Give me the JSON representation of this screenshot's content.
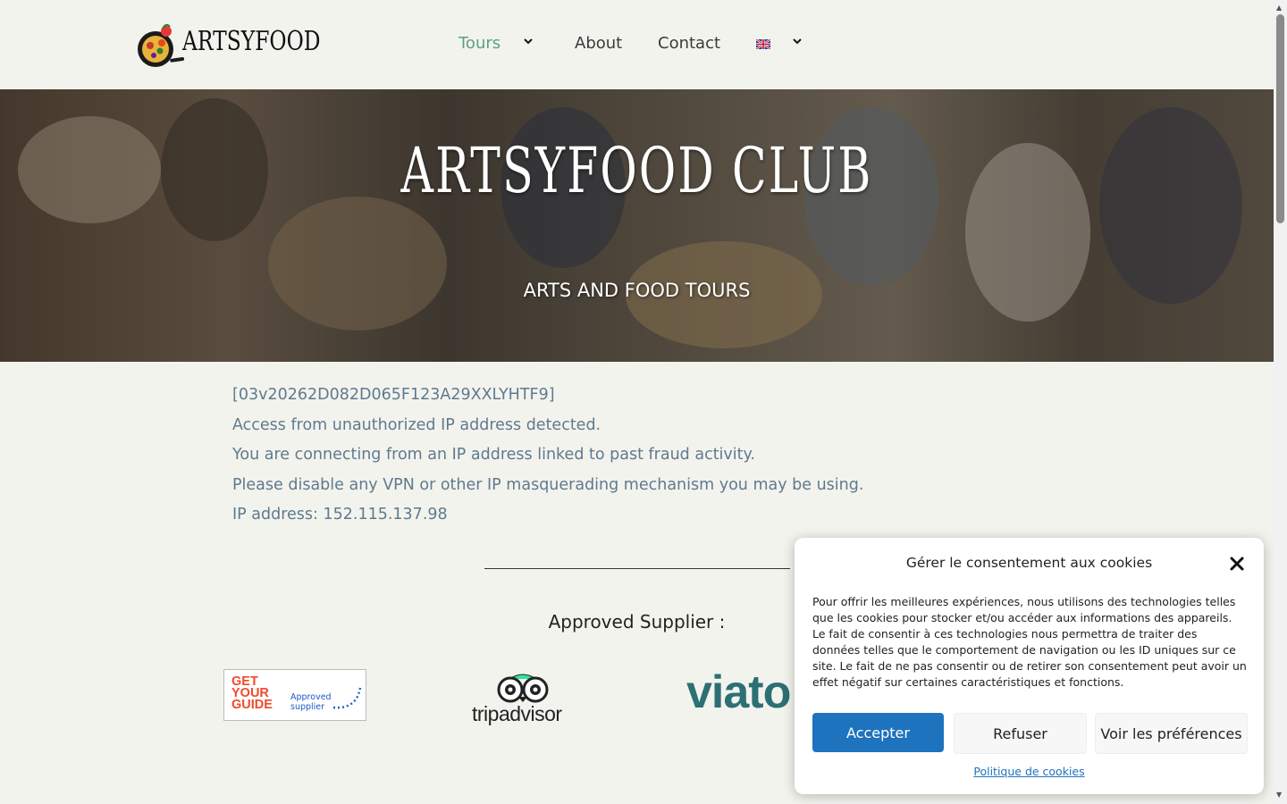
{
  "brand": {
    "logo_text": "ARTSYFOOD"
  },
  "nav": {
    "items": [
      {
        "label": "Tours",
        "active": true,
        "has_dropdown": true
      },
      {
        "label": "About",
        "active": false,
        "has_dropdown": false
      },
      {
        "label": "Contact",
        "active": false,
        "has_dropdown": false
      }
    ],
    "language_icon": "uk-flag-icon"
  },
  "hero": {
    "title": "ARTSYFOOD CLUB",
    "subtitle": "ARTS AND FOOD TOURS"
  },
  "message": {
    "lines": [
      "[03v20262D082D065F123A29XXLYHTF9]",
      "Access from unauthorized IP address detected.",
      "You are connecting from an IP address linked to past fraud activity.",
      "Please disable any VPN or other IP masquerading mechanism you may be using.",
      "IP address: 152.115.137.98"
    ]
  },
  "suppliers": {
    "heading": "Approved Supplier :",
    "gyg": {
      "big": "GET YOUR GUIDE",
      "small": "Approved supplier"
    },
    "tripadvisor": {
      "text": "tripadvisor"
    },
    "viator": {
      "text": "viator"
    }
  },
  "cookie": {
    "title": "Gérer le consentement aux cookies",
    "text": "Pour offrir les meilleures expériences, nous utilisons des technologies telles que les cookies pour stocker et/ou accéder aux informations des appareils. Le fait de consentir à ces technologies nous permettra de traiter des données telles que le comportement de navigation ou les ID uniques sur ce site. Le fait de ne pas consentir ou de retirer son consentement peut avoir un effet négatif sur certaines caractéristiques et fonctions.",
    "accept": "Accepter",
    "refuse": "Refuser",
    "prefs": "Voir les préférences",
    "policy": "Politique de cookies"
  },
  "colors": {
    "accent": "#1e73be",
    "nav_active": "#5aa27c",
    "message_text": "#5f7a8d",
    "viator": "#2c7074",
    "gyg": "#f04a2a"
  }
}
